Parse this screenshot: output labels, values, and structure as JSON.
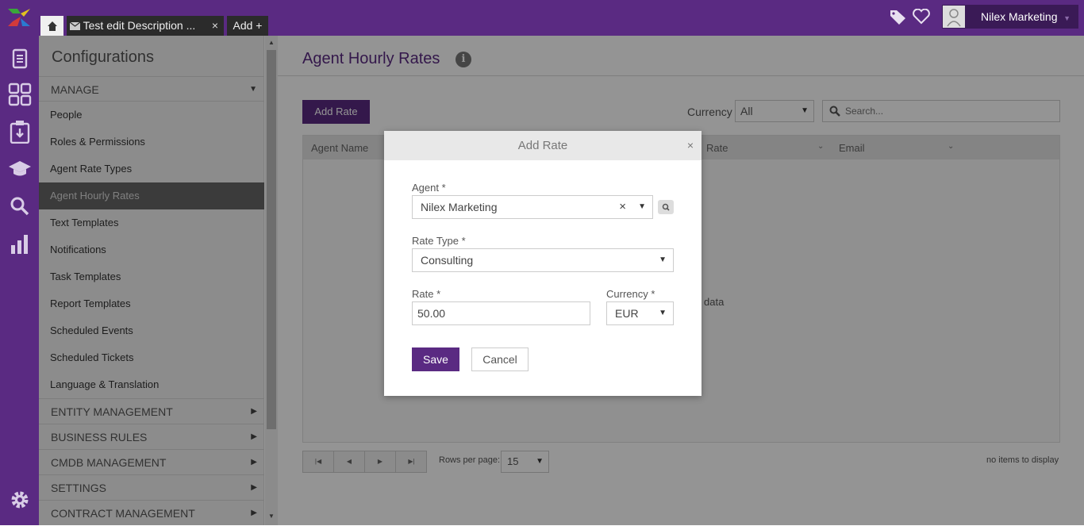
{
  "tabs": {
    "doc_label": "Test edit Description ...",
    "doc_close": "×",
    "add_label": "Add +"
  },
  "user": {
    "name": "Nilex Marketing",
    "caret": "▼"
  },
  "config": {
    "title": "Configurations",
    "manage_section": "MANAGE",
    "manage_caret": "▼",
    "items": [
      "People",
      "Roles & Permissions",
      "Agent Rate Types",
      "Agent Hourly Rates",
      "Text Templates",
      "Notifications",
      "Task Templates",
      "Report Templates",
      "Scheduled Events",
      "Scheduled Tickets",
      "Language & Translation"
    ],
    "sections": [
      "ENTITY MANAGEMENT",
      "BUSINESS RULES",
      "CMDB MANAGEMENT",
      "SETTINGS",
      "CONTRACT MANAGEMENT"
    ],
    "section_caret": "▶"
  },
  "main": {
    "title": "Agent Hourly Rates",
    "info": "i",
    "add_rate": "Add Rate",
    "currency_label": "Currency",
    "currency_value": "All",
    "search_placeholder": "Search...",
    "columns": [
      "Agent Name",
      "Rate",
      "Email"
    ],
    "no_data": "data",
    "rows_per_page_label": "Rows per page:",
    "rows_per_page": "15",
    "no_items": "no items to display"
  },
  "modal": {
    "title": "Add Rate",
    "close": "×",
    "agent_label": "Agent *",
    "agent_value": "Nilex Marketing",
    "agent_clear": "×",
    "rate_type_label": "Rate Type *",
    "rate_type_value": "Consulting",
    "rate_label": "Rate *",
    "rate_value": "50.00",
    "currency_label": "Currency *",
    "currency_value": "EUR",
    "save": "Save",
    "cancel": "Cancel"
  },
  "colors": {
    "brand": "#5a2a82"
  }
}
